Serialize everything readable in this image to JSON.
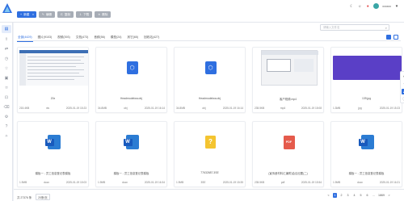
{
  "toolbar": {
    "new_label": "新建",
    "edit_label": "编辑",
    "copy_label": "复制",
    "download_label": "下载",
    "delete_label": "删除"
  },
  "header": {
    "username": "xxxxxx"
  },
  "search": {
    "placeholder": "请输入文件名"
  },
  "tabs": [
    {
      "label": "全部(4429)"
    },
    {
      "label": "图片(9103)"
    },
    {
      "label": "视频(393)"
    },
    {
      "label": "文档(473)"
    },
    {
      "label": "音频(56)"
    },
    {
      "label": "模型(24)"
    },
    {
      "label": "其它(65)"
    },
    {
      "label": "回收站(427)"
    }
  ],
  "cards": [
    {
      "name": "20x",
      "size": "215.4KB",
      "type": "xls",
      "date": "2025-01-19 15:23"
    },
    {
      "name": "Headmodelwa.obj",
      "size": "34.8MB",
      "type": "obj",
      "date": "2025-01-19 16:14"
    },
    {
      "name": "Headmodelwa.obj",
      "size": "34.8MB",
      "type": "obj",
      "date": "2025-01-19 16:14"
    },
    {
      "name": "客户视频.mp4",
      "size": "235.5KB",
      "type": "mp4",
      "date": "2025-01-19 15:08"
    },
    {
      "name": "139.jpg",
      "size": "1.3MB",
      "type": "jpg",
      "date": "2025-01-19 15:23"
    },
    {
      "name": "模板一 - 员工信息登记表模板",
      "size": "1.9MB",
      "type": "docx",
      "date": "2025-01-19 15:03"
    },
    {
      "name": "模板一 - 员工信息登记表模板",
      "size": "1.9MB",
      "type": "docx",
      "date": "2025-01-19 16:34"
    },
    {
      "name": "77632687.3SE",
      "size": "1.9MB",
      "type": "3SE",
      "date": "2025-01-19 15:35"
    },
    {
      "name": "(宣传册材料汇编附)会议纪要(二)",
      "size": "235.5KB",
      "type": "pdf",
      "date": "2025-01-19 15:54"
    },
    {
      "name": "模板一 - 员工信息登记表模板",
      "size": "1.9MB",
      "type": "docx",
      "date": "2025-01-19 16:21"
    }
  ],
  "footer": {
    "total": "共 27376 条",
    "page_size": "20条/页",
    "pages": [
      "1",
      "2",
      "3",
      "4",
      "5",
      "6",
      "...",
      "1869"
    ],
    "prev": "<",
    "next": ">"
  },
  "colors": {
    "accent": "#2f6fe0",
    "word": "#2b7cd3",
    "pdf": "#e55b4c",
    "purple": "#5a3fc6"
  }
}
